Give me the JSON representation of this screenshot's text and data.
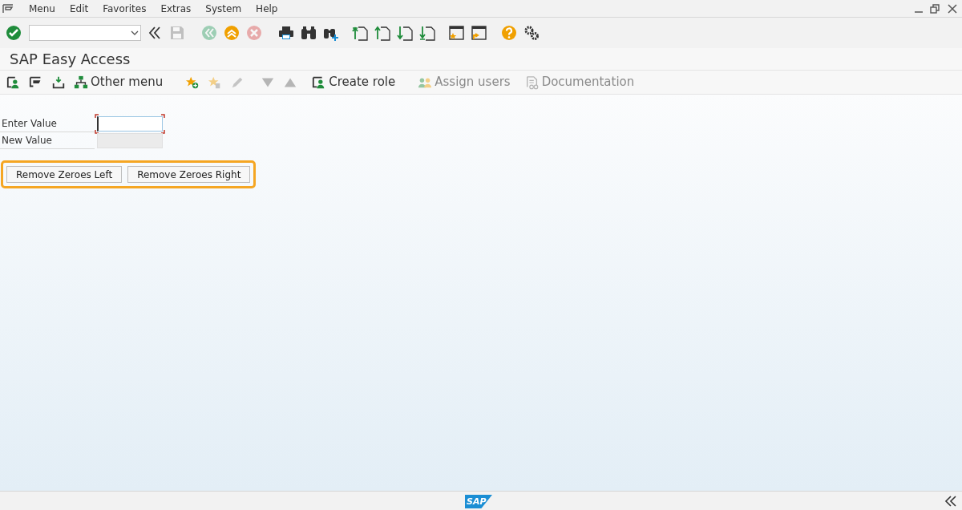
{
  "menu_bar": {
    "items": [
      "Menu",
      "Edit",
      "Favorites",
      "Extras",
      "System",
      "Help"
    ]
  },
  "toolbar": {
    "buttons": [
      {
        "kind": "enter",
        "disabled": false
      },
      {
        "kind": "collapse",
        "disabled": false
      },
      {
        "kind": "save",
        "disabled": true
      },
      {
        "kind": "back",
        "disabled": true
      },
      {
        "kind": "exit",
        "disabled": false
      },
      {
        "kind": "cancel",
        "disabled": true
      },
      {
        "kind": "print",
        "disabled": false
      },
      {
        "kind": "find",
        "disabled": false
      },
      {
        "kind": "find-next",
        "disabled": false
      },
      {
        "kind": "first-page",
        "disabled": false
      },
      {
        "kind": "prev-page",
        "disabled": false
      },
      {
        "kind": "next-page",
        "disabled": false
      },
      {
        "kind": "last-page",
        "disabled": false
      },
      {
        "kind": "new-session",
        "disabled": false
      },
      {
        "kind": "shortcut",
        "disabled": false
      },
      {
        "kind": "help",
        "disabled": false
      },
      {
        "kind": "settings",
        "disabled": false
      }
    ]
  },
  "title": "SAP Easy Access",
  "app_toolbar": [
    {
      "kind": "user-menu",
      "disabled": false
    },
    {
      "kind": "sap-menu",
      "disabled": false
    },
    {
      "kind": "business-workplace",
      "disabled": false
    },
    {
      "kind": "other-menu",
      "label": "Other menu",
      "disabled": false
    },
    {
      "kind": "add-favorite",
      "disabled": false
    },
    {
      "kind": "delete-favorite",
      "disabled": true
    },
    {
      "kind": "edit",
      "disabled": true
    },
    {
      "kind": "move-down",
      "disabled": true
    },
    {
      "kind": "move-up",
      "disabled": true
    },
    {
      "kind": "create-role",
      "label": "Create role",
      "disabled": false
    },
    {
      "kind": "assign-users",
      "label": "Assign users",
      "disabled": true
    },
    {
      "kind": "documentation",
      "label": "Documentation",
      "disabled": true
    }
  ],
  "form": {
    "fields": [
      {
        "label": "Enter Value",
        "disabled": false,
        "focused": true
      },
      {
        "label": "New Value",
        "disabled": true,
        "focused": false
      }
    ],
    "buttons": [
      "Remove Zeroes Left",
      "Remove Zeroes Right"
    ],
    "highlighted": true
  },
  "status_bar": {
    "logo": "SAP"
  }
}
